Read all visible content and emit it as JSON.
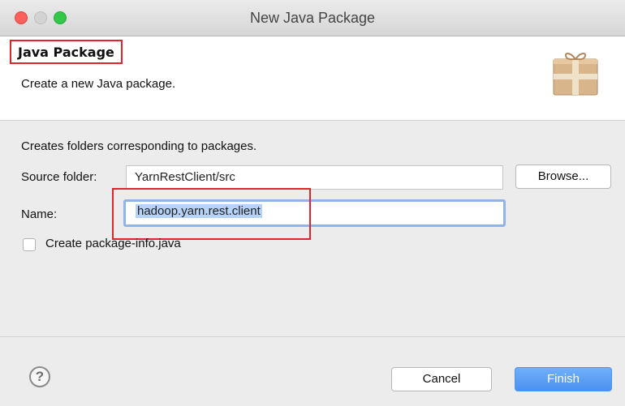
{
  "window": {
    "title": "New Java Package"
  },
  "header": {
    "title": "Java Package",
    "description": "Create a new Java package.",
    "icon": "package-icon"
  },
  "form": {
    "intro": "Creates folders corresponding to packages.",
    "source_folder": {
      "label": "Source folder:",
      "value": "YarnRestClient/src"
    },
    "browse_label": "Browse...",
    "name": {
      "label": "Name:",
      "value": "hadoop.yarn.rest.client"
    },
    "package_info": {
      "label": "Create package-info.java",
      "checked": false
    }
  },
  "footer": {
    "help_icon": "help-icon",
    "help_glyph": "?",
    "cancel_label": "Cancel",
    "finish_label": "Finish"
  },
  "colors": {
    "highlight": "#e0242a",
    "focus_ring": "#8fb4e6",
    "selection": "#b4d3f7",
    "primary_button": "#4b91f0",
    "close": "#fc605c",
    "zoom": "#34c84a"
  }
}
